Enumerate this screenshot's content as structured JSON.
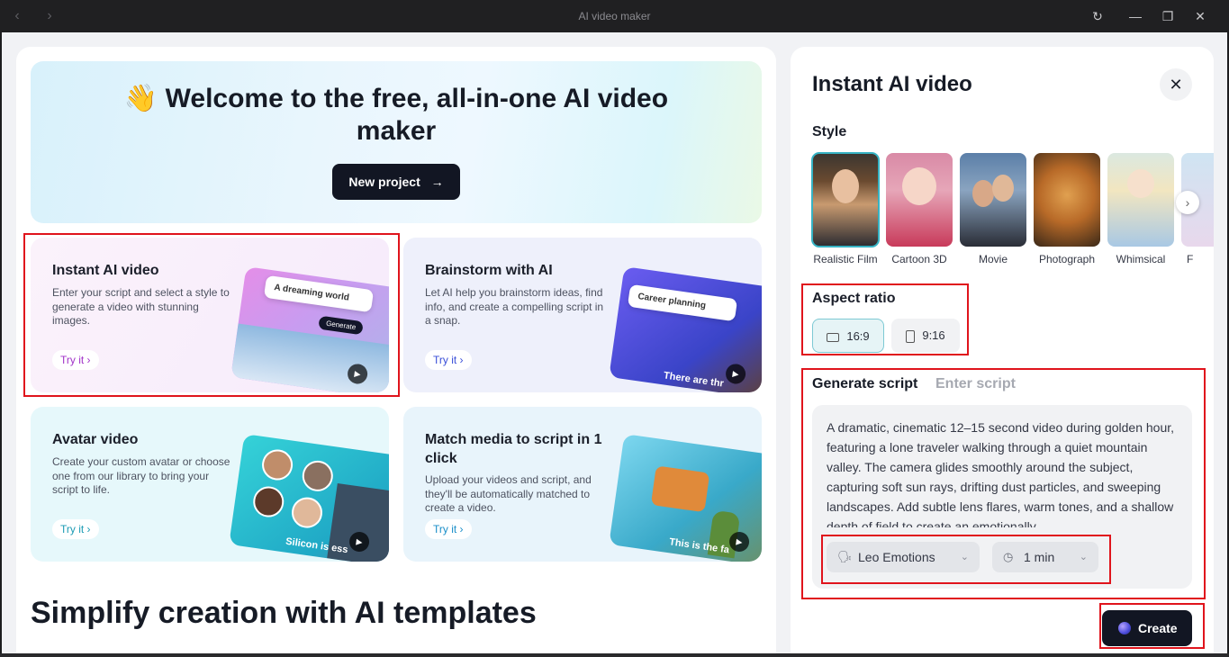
{
  "window": {
    "title": "AI video maker",
    "back_icon": "chevron-left-icon",
    "forward_icon": "chevron-right-icon",
    "controls": [
      "refresh-icon",
      "minimize-icon",
      "restore-icon",
      "close-icon"
    ]
  },
  "hero": {
    "emoji": "👋",
    "title": "Welcome to the free, all-in-one AI video maker",
    "new_project_label": "New project",
    "new_project_arrow": "→"
  },
  "cards": [
    {
      "title": "Instant AI video",
      "description": "Enter your script and select a style to generate a video with stunning images.",
      "cta": "Try it",
      "bubble": "A dreaming world",
      "pill": "Generate"
    },
    {
      "title": "Brainstorm with AI",
      "description": "Let AI help you brainstorm ideas, find info, and create a compelling script in a snap.",
      "cta": "Try it",
      "bubble": "Career planning",
      "overlay": "There are thr"
    },
    {
      "title": "Avatar video",
      "description": "Create your custom avatar or choose one from our library to bring your script to life.",
      "cta": "Try it",
      "overlay": "Silicon is ess"
    },
    {
      "title": "Match media to script in 1 click",
      "description": "Upload your videos and script, and they'll be automatically matched to create a video.",
      "cta": "Try it",
      "overlay": "This is the fa"
    }
  ],
  "templates_title": "Simplify creation with AI templates",
  "panel": {
    "title": "Instant AI video",
    "style_label": "Style",
    "styles": [
      {
        "name": "Realistic Film",
        "selected": true
      },
      {
        "name": "Cartoon 3D",
        "selected": false
      },
      {
        "name": "Movie",
        "selected": false
      },
      {
        "name": "Photograph",
        "selected": false
      },
      {
        "name": "Whimsical",
        "selected": false
      },
      {
        "name": "F",
        "selected": false
      }
    ],
    "aspect_label": "Aspect ratio",
    "aspect_options": [
      {
        "label": "16:9",
        "selected": true
      },
      {
        "label": "9:16",
        "selected": false
      }
    ],
    "tab_generate": "Generate script",
    "tab_enter": "Enter script",
    "script": "A dramatic, cinematic 12–15 second video during golden hour, featuring a lone traveler walking through a quiet mountain valley. The camera glides smoothly around the subject, capturing soft sun rays, drifting dust particles, and sweeping landscapes. Add subtle lens flares, warm tones, and a shallow depth of field to create an emotionally",
    "voice": "Leo Emotions",
    "duration": "1 min",
    "create_label": "Create"
  },
  "colors": {
    "accent_dark": "#121623",
    "selected_outline": "#36b3c4",
    "highlight_red": "#e0141c"
  }
}
